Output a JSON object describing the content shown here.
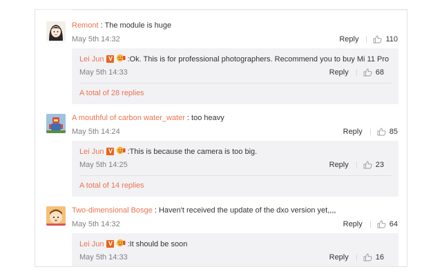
{
  "comments": [
    {
      "user": "Remont",
      "text": "The module is huge",
      "time": "May 5th 14:32",
      "reply_label": "Reply",
      "likes": "110",
      "avatar_icon": "girl-avatar-icon",
      "sub_reply": {
        "user": "Lei Jun",
        "text": "Ok. This is for professional photographers. Recommend you to buy Mi 11 Pro",
        "time": "May 5th 14:33",
        "reply_label": "Reply",
        "likes": "68"
      },
      "total_replies": "A total of 28 replies"
    },
    {
      "user": "A mouthful of carbon water_water",
      "text": "too heavy",
      "time": "May 5th 14:24",
      "reply_label": "Reply",
      "likes": "85",
      "avatar_icon": "robot-avatar-icon",
      "sub_reply": {
        "user": "Lei Jun",
        "text": "This is because the camera is too big.",
        "time": "May 5th 14:25",
        "reply_label": "Reply",
        "likes": "23"
      },
      "total_replies": "A total of 14 replies"
    },
    {
      "user": "Two-dimensional Bosge",
      "text": "Haven't received the update of the dxo version yet,,,,",
      "time": "May 5th 14:32",
      "reply_label": "Reply",
      "likes": "64",
      "avatar_icon": "cartoon-avatar-icon",
      "sub_reply": {
        "user": "Lei Jun",
        "text": "It should be soon",
        "time": "May 5th 14:33",
        "reply_label": "Reply",
        "likes": "16"
      }
    }
  ],
  "colors": {
    "username": "#eb7350",
    "meta": "#808080",
    "reply_box": "#f2f2f5",
    "vip_badge": "#e8641b"
  },
  "badge_letter": "V",
  "sticker_icon": "cheer-emoji-icon",
  "like_icon": "thumbs-up-icon"
}
